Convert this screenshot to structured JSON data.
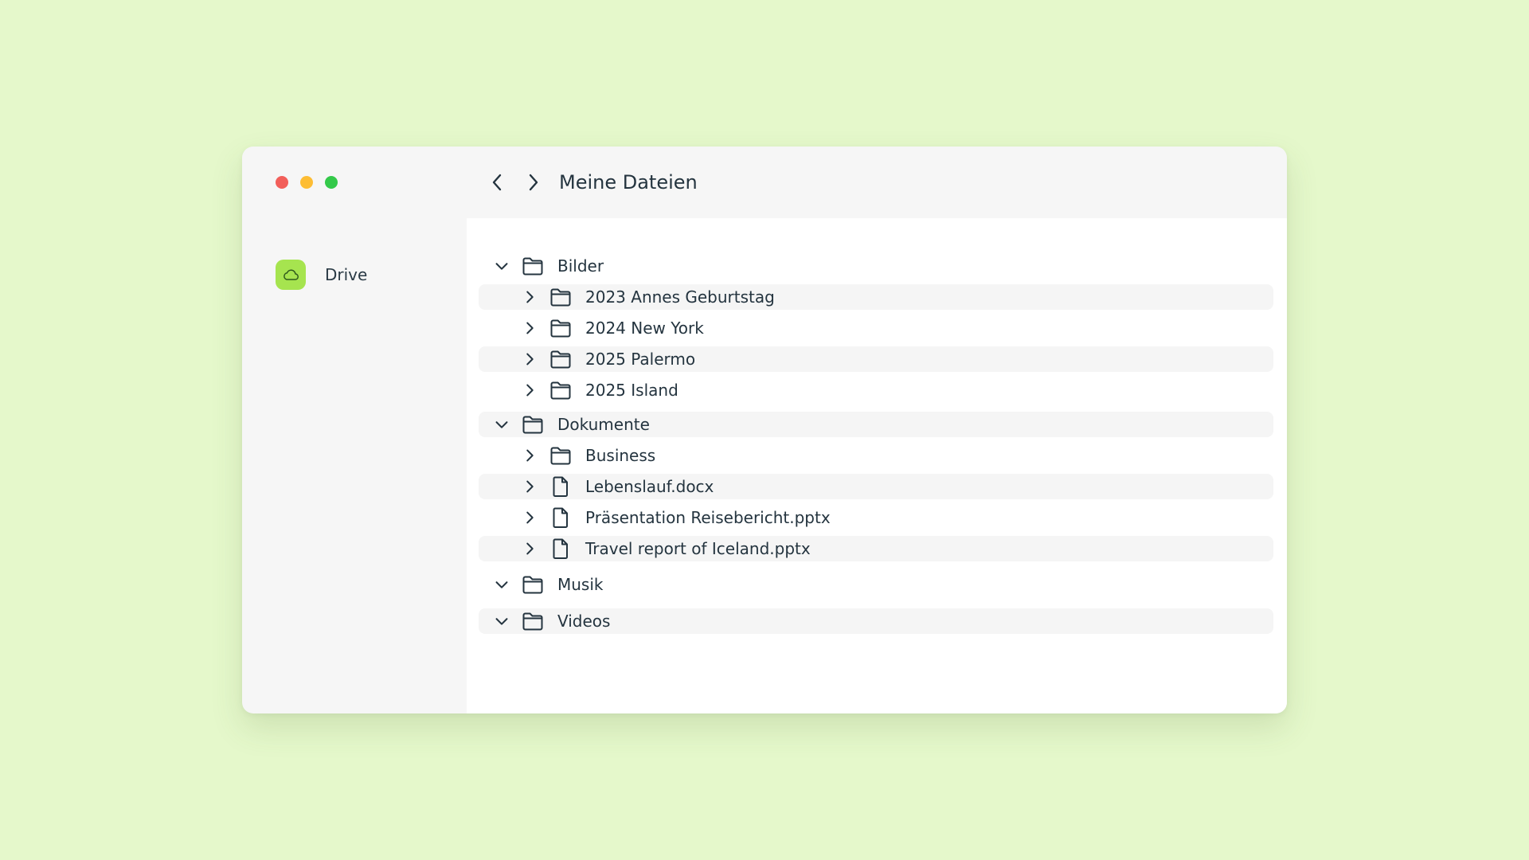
{
  "window": {
    "title": "Meine Dateien"
  },
  "sidebar": {
    "items": [
      {
        "label": "Drive",
        "icon": "cloud-icon",
        "color": "#a6e44f"
      }
    ]
  },
  "tree": {
    "bilder": {
      "label": "Bilder",
      "children": [
        "2023 Annes Geburtstag",
        "2024 New York",
        "2025 Palermo",
        "2025 Island"
      ]
    },
    "dokumente": {
      "label": "Dokumente",
      "children": [
        "Business",
        "Lebenslauf.docx",
        "Präsentation Reisebericht.pptx",
        "Travel report of Iceland.pptx"
      ]
    },
    "musik": {
      "label": "Musik"
    },
    "videos": {
      "label": "Videos"
    }
  },
  "colors": {
    "background": "#e5f8cb",
    "accent": "#a6e44f",
    "close": "#f25f5a",
    "minimize": "#fdbd34",
    "maximize": "#34c94a"
  }
}
